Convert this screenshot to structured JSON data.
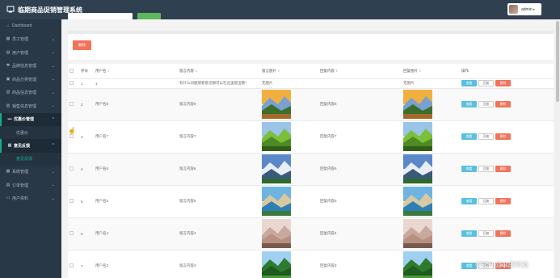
{
  "app": {
    "title": "临期商品促销管理系统"
  },
  "user": {
    "name": "admin",
    "caret": "▾"
  },
  "sidebar": {
    "items": [
      {
        "label": "Dashboard",
        "icon": "home-icon",
        "glyph": "⌂",
        "chev": ""
      },
      {
        "label": "员工管理",
        "icon": "grid-icon",
        "glyph": "▦",
        "chev": "⌄"
      },
      {
        "label": "用户管理",
        "icon": "chart-icon",
        "glyph": "▤",
        "chev": "⌄"
      },
      {
        "label": "品牌信息管理",
        "icon": "tag-icon",
        "glyph": "✱",
        "chev": "⌄"
      },
      {
        "label": "商品分类管理",
        "icon": "box-icon",
        "glyph": "▣",
        "chev": "⌄"
      },
      {
        "label": "商品信息管理",
        "icon": "list-icon",
        "glyph": "▥",
        "chev": "⌄"
      },
      {
        "label": "销售信息管理",
        "icon": "cart-icon",
        "glyph": "▧",
        "chev": "⌄"
      },
      {
        "label": "优惠价管理",
        "icon": "ticket-icon",
        "glyph": "▬",
        "chev": "⌃"
      },
      {
        "label": "优惠价",
        "sub": true
      },
      {
        "label": "意见反馈",
        "icon": "comment-icon",
        "glyph": "▩",
        "chev": "⌃"
      },
      {
        "label": "意见反馈",
        "sub": true,
        "current": true
      },
      {
        "label": "系统管理",
        "icon": "settings-icon",
        "glyph": "▦",
        "chev": "⌄"
      },
      {
        "label": "订单管理",
        "icon": "order-icon",
        "glyph": "▤",
        "chev": "⌄"
      },
      {
        "label": "用户资料",
        "icon": "profile-icon",
        "glyph": "▭",
        "chev": "⌄"
      }
    ]
  },
  "toolbar": {
    "delete_label": "删除"
  },
  "table": {
    "headers": [
      "",
      "序号",
      "用户名",
      "留言内容",
      "留言图片",
      "回复内容",
      "回复图片",
      "操作"
    ],
    "sort_glyph": "⇕",
    "ops": {
      "view": "查看",
      "reply": "回复",
      "delete": "删除"
    },
    "rows": [
      {
        "no": "1",
        "user": "1",
        "content": "有什么问题或者意见都可以在这里提出哦！",
        "img": "无图片",
        "reply": "",
        "reply_img": "无图片",
        "tall": false
      },
      {
        "no": "2",
        "user": "用户名8",
        "content": "留言内容8",
        "img": "",
        "reply": "回复内容8",
        "reply_img": "",
        "tall": true,
        "pic": "sunset"
      },
      {
        "no": "3",
        "user": "用户名7",
        "content": "留言内容7",
        "img": "",
        "reply": "回复内容7",
        "reply_img": "",
        "tall": true,
        "pic": "terrace"
      },
      {
        "no": "4",
        "user": "用户名6",
        "content": "留言内容6",
        "img": "",
        "reply": "回复内容6",
        "reply_img": "",
        "tall": true,
        "pic": "mountain"
      },
      {
        "no": "5",
        "user": "用户名5",
        "content": "留言内容5",
        "img": "",
        "reply": "回复内容5",
        "reply_img": "",
        "tall": true,
        "pic": "lake"
      },
      {
        "no": "6",
        "user": "用户名4",
        "content": "留言内容4",
        "img": "",
        "reply": "回复内容4",
        "reply_img": "",
        "tall": true,
        "pic": "mist"
      },
      {
        "no": "7",
        "user": "用户名3",
        "content": "留言内容3",
        "img": "",
        "reply": "回复内容3",
        "reply_img": "",
        "tall": true,
        "pic": "forest"
      }
    ]
  },
  "watermark": "CSDN @qq的科技"
}
